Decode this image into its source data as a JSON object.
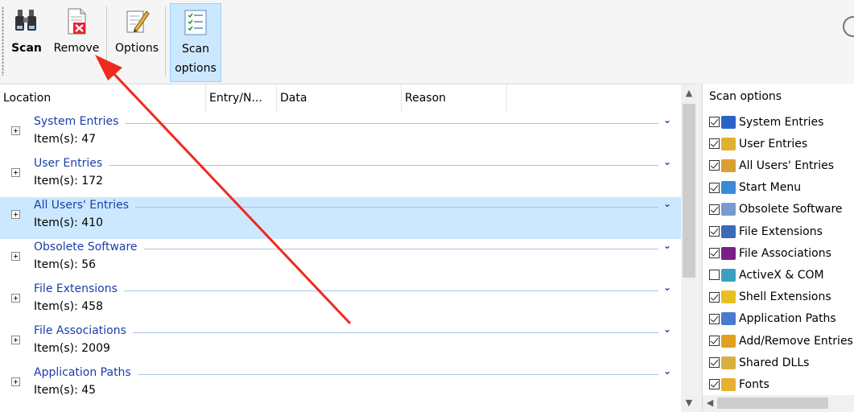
{
  "toolbar": {
    "buttons": [
      {
        "label": "Scan",
        "icon": "binoculars-icon"
      },
      {
        "label": "Remove",
        "icon": "delete-document-icon"
      },
      {
        "label": "Options",
        "icon": "options-pencil-icon"
      },
      {
        "label": "Scan options",
        "icon": "checklist-icon"
      }
    ]
  },
  "list": {
    "columns": [
      "Location",
      "Entry/N...",
      "Data",
      "Reason"
    ],
    "groups": [
      {
        "title": "System Entries",
        "count": "Item(s): 47"
      },
      {
        "title": "User Entries",
        "count": "Item(s): 172"
      },
      {
        "title": "All Users' Entries",
        "count": "Item(s): 410",
        "selected": true
      },
      {
        "title": "Obsolete Software",
        "count": "Item(s): 56"
      },
      {
        "title": "File Extensions",
        "count": "Item(s): 458"
      },
      {
        "title": "File Associations",
        "count": "Item(s): 2009"
      },
      {
        "title": "Application Paths",
        "count": "Item(s): 45"
      }
    ]
  },
  "scan_options": {
    "title": "Scan options",
    "items": [
      {
        "label": "System Entries",
        "checked": true,
        "color": "#2a63c8"
      },
      {
        "label": "User Entries",
        "checked": true,
        "color": "#e0b030"
      },
      {
        "label": "All Users' Entries",
        "checked": true,
        "color": "#d8a030"
      },
      {
        "label": "Start Menu",
        "checked": true,
        "color": "#3a8ad8"
      },
      {
        "label": "Obsolete Software",
        "checked": true,
        "color": "#7a9ad0"
      },
      {
        "label": "File Extensions",
        "checked": true,
        "color": "#3a6ab8"
      },
      {
        "label": "File Associations",
        "checked": true,
        "color": "#7a1f8a"
      },
      {
        "label": "ActiveX & COM",
        "checked": false,
        "color": "#3aa0c0"
      },
      {
        "label": "Shell Extensions",
        "checked": true,
        "color": "#e8c020"
      },
      {
        "label": "Application Paths",
        "checked": true,
        "color": "#4a7ad0"
      },
      {
        "label": "Add/Remove Entries",
        "checked": true,
        "color": "#e0a020"
      },
      {
        "label": "Shared DLLs",
        "checked": true,
        "color": "#d8b040"
      },
      {
        "label": "Fonts",
        "checked": true,
        "color": "#e8b030"
      }
    ]
  },
  "colors": {
    "accent": "#1a3da8",
    "selection": "#cce8ff",
    "arrow": "#ee2a1f"
  }
}
